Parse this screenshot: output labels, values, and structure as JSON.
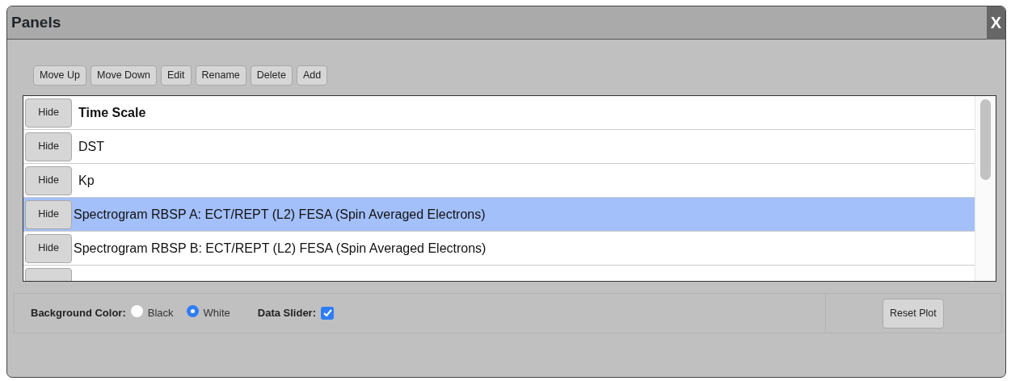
{
  "window": {
    "title": "Panels",
    "close": "X"
  },
  "toolbar": [
    "Move Up",
    "Move Down",
    "Edit",
    "Rename",
    "Delete",
    "Add"
  ],
  "panels": [
    {
      "kind": "heading",
      "button": "Hide",
      "label": "Time Scale",
      "selected": false
    },
    {
      "kind": "panel",
      "button": "Hide",
      "label": "DST",
      "selected": false
    },
    {
      "kind": "panel",
      "button": "Hide",
      "label": "Kp",
      "selected": false
    },
    {
      "kind": "panel",
      "button": "Hide",
      "label": "Spectrogram RBSP A: ECT/REPT (L2) FESA (Spin Averaged Electrons)",
      "selected": true
    },
    {
      "kind": "panel",
      "button": "Hide",
      "label": "Spectrogram RBSP B: ECT/REPT (L2) FESA (Spin Averaged Electrons)",
      "selected": false
    },
    {
      "kind": "cut-off",
      "selected": false
    }
  ],
  "options": {
    "background_label": "Background Color:",
    "background_choices": [
      {
        "label": "Black",
        "selected": false
      },
      {
        "label": "White",
        "selected": true
      }
    ],
    "slider_label": "Data Slider:",
    "slider_checked": true
  },
  "reset_button": "Reset Plot"
}
